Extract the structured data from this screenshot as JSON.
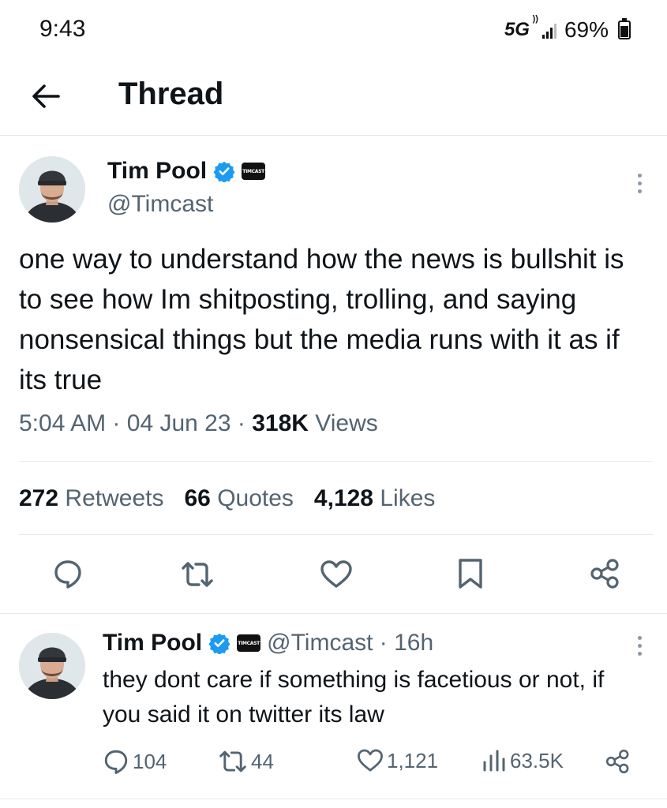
{
  "status_bar": {
    "time": "9:43",
    "network": "5G",
    "battery": "69%"
  },
  "header": {
    "title": "Thread"
  },
  "main_tweet": {
    "author_name": "Tim Pool",
    "org_badge_text": "TIMCAST",
    "handle": "@Timcast",
    "text": "one way to understand how the news is bullshit is to see how Im shitposting, trolling, and saying nonsensical things but the media runs with it as if its true",
    "time": "5:04 AM",
    "date": "04 Jun 23",
    "views_count": "318K",
    "views_label": "Views",
    "sep": "·",
    "retweets_count": "272",
    "retweets_label": "Retweets",
    "quotes_count": "66",
    "quotes_label": "Quotes",
    "likes_count": "4,128",
    "likes_label": "Likes"
  },
  "reply": {
    "author_name": "Tim Pool",
    "org_badge_text": "TIMCAST",
    "handle_time": "@Timcast · 16h",
    "text": "they dont care if something is facetious or not, if you said it on twitter its law",
    "replies": "104",
    "retweets": "44",
    "likes": "1,121",
    "views": "63.5K"
  },
  "colors": {
    "verified_blue": "#1d9bf0",
    "secondary_text": "#536471",
    "primary_text": "#0f1419",
    "divider": "#e6e9ec"
  },
  "icons": [
    "back-arrow-icon",
    "verified-icon",
    "more-icon",
    "reply-icon",
    "retweet-icon",
    "like-icon",
    "bookmark-icon",
    "share-icon",
    "views-icon"
  ]
}
